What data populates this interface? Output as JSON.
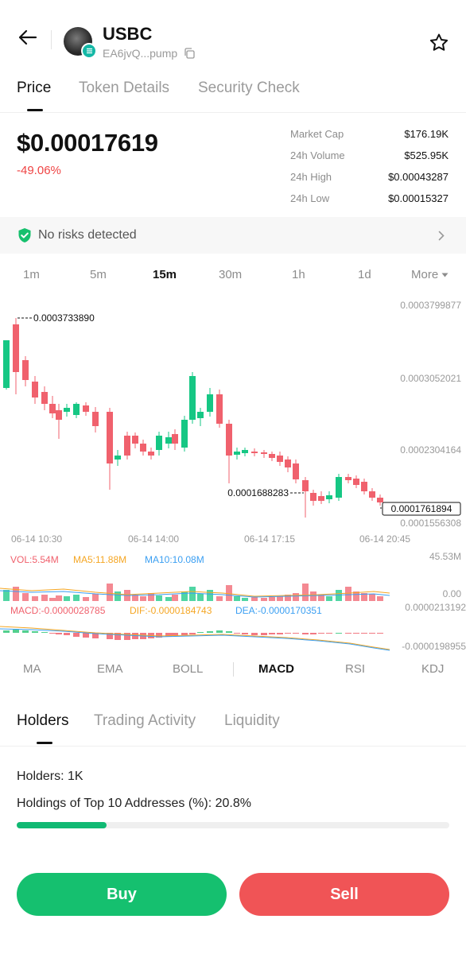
{
  "header": {
    "token_name": "USBC",
    "token_address": "EA6jvQ...pump",
    "icons": [
      "back-arrow-icon",
      "copy-icon",
      "star-icon",
      "solana-badge-icon"
    ]
  },
  "tabs": [
    "Price",
    "Token Details",
    "Security Check"
  ],
  "price": {
    "current": "$0.00017619",
    "change": "-49.06%"
  },
  "stats": [
    {
      "label": "Market Cap",
      "value": "$176.19K"
    },
    {
      "label": "24h Volume",
      "value": "$525.95K"
    },
    {
      "label": "24h High",
      "value": "$0.00043287"
    },
    {
      "label": "24h Low",
      "value": "$0.00015327"
    }
  ],
  "risk": {
    "text": "No risks detected"
  },
  "intervals": [
    "1m",
    "5m",
    "15m",
    "30m",
    "1h",
    "1d",
    "More"
  ],
  "active_interval": "15m",
  "chart": {
    "y_ticks": [
      "0.0003799877",
      "0.0003052021",
      "0.0002304164",
      "0.0001556308"
    ],
    "x_ticks": [
      "06-14 10:30",
      "06-14 14:00",
      "06-14 17:15",
      "06-14 20:45"
    ],
    "high_marker": "0.0003733890",
    "low_marker": "0.0001688283",
    "last_price": "0.0001761894",
    "vol_label": "VOL:5.54M",
    "ma5_label": "MA5:11.88M",
    "ma10_label": "MA10:10.08M",
    "vol_max": "45.53M",
    "vol_min": "0.00",
    "macd_label": "MACD:-0.0000028785",
    "dif_label": "DIF:-0.0000184743",
    "dea_label": "DEA:-0.0000170351",
    "macd_top": "0.0000213192",
    "macd_bottom": "-0.0000198955",
    "colors": {
      "up": "#16c784",
      "down": "#f0616d",
      "ma5": "#f5a623",
      "ma10": "#3b9ff2",
      "macd_pos": "#34c77b",
      "macd_neg": "#f0616d"
    }
  },
  "indicators": [
    "MA",
    "EMA",
    "BOLL",
    "MACD",
    "RSI",
    "KDJ"
  ],
  "active_indicator": "MACD",
  "bottom_tabs": [
    "Holders",
    "Trading Activity",
    "Liquidity"
  ],
  "holders": {
    "holders_text": "Holders: 1K",
    "top10_text": "Holdings of Top 10 Addresses (%): 20.8%",
    "top10_percent": 20.8
  },
  "actions": {
    "buy": "Buy",
    "sell": "Sell"
  }
}
